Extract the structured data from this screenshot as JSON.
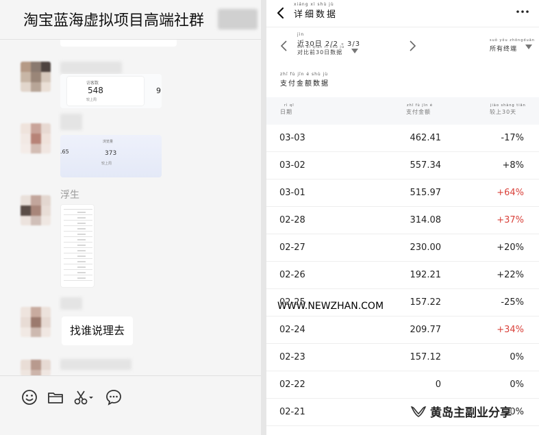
{
  "chat": {
    "title": "淘宝蓝海虚拟项目高端社群",
    "sender_name": "浮生",
    "bubble_text": "找谁说理去",
    "card1": {
      "label": "访客数",
      "value": "548",
      "sub": "较上周"
    },
    "card2": {
      "left": ".65",
      "label": "浏览量",
      "value": "373",
      "sub": "较上周"
    }
  },
  "detail": {
    "back_icon": "chevron-left-icon",
    "title": "详细数据",
    "title_pinyin": "xiáng xì shù jù",
    "more_icon": "more-horizontal-icon",
    "range_pinyin": "jìn",
    "range_text": "近30日  2/2 - 3/3",
    "compare_text": "对比前30日数据",
    "compare_pinyin": "duì bǐ qián    rì shù jù",
    "terminal_text": "所有终端",
    "terminal_pinyin": "suǒ yǒu zhōngduān",
    "section_title": "支付金额数据",
    "section_pinyin": "zhī fù jīn é shù jù",
    "columns": [
      {
        "label": "日期",
        "pinyin": "rì qī"
      },
      {
        "label": "支付金额",
        "pinyin": "zhī fù jīn é"
      },
      {
        "label": "较上30天",
        "pinyin": "jiào shàng    tiān"
      }
    ],
    "rows": [
      {
        "date": "03-03",
        "amount": "462.41",
        "change": "-17%",
        "up": false
      },
      {
        "date": "03-02",
        "amount": "557.34",
        "change": "+8%",
        "up": false
      },
      {
        "date": "03-01",
        "amount": "515.97",
        "change": "+64%",
        "up": true
      },
      {
        "date": "02-28",
        "amount": "314.08",
        "change": "+37%",
        "up": true
      },
      {
        "date": "02-27",
        "amount": "230.00",
        "change": "+20%",
        "up": false
      },
      {
        "date": "02-26",
        "amount": "192.21",
        "change": "+22%",
        "up": false
      },
      {
        "date": "02-25",
        "amount": "157.22",
        "change": "-25%",
        "up": false
      },
      {
        "date": "02-24",
        "amount": "209.77",
        "change": "+34%",
        "up": true
      },
      {
        "date": "02-23",
        "amount": "157.12",
        "change": "0%",
        "up": false
      },
      {
        "date": "02-22",
        "amount": "0",
        "change": "0%",
        "up": false
      },
      {
        "date": "02-21",
        "amount": "",
        "change": "0%",
        "up": false
      }
    ]
  },
  "watermarks": {
    "url": "WWW.NEWZHAN.COM",
    "brand": "黄岛主副业分享"
  },
  "colors": {
    "up": "#d9413a",
    "chat_bg": "#f5f5f5"
  }
}
